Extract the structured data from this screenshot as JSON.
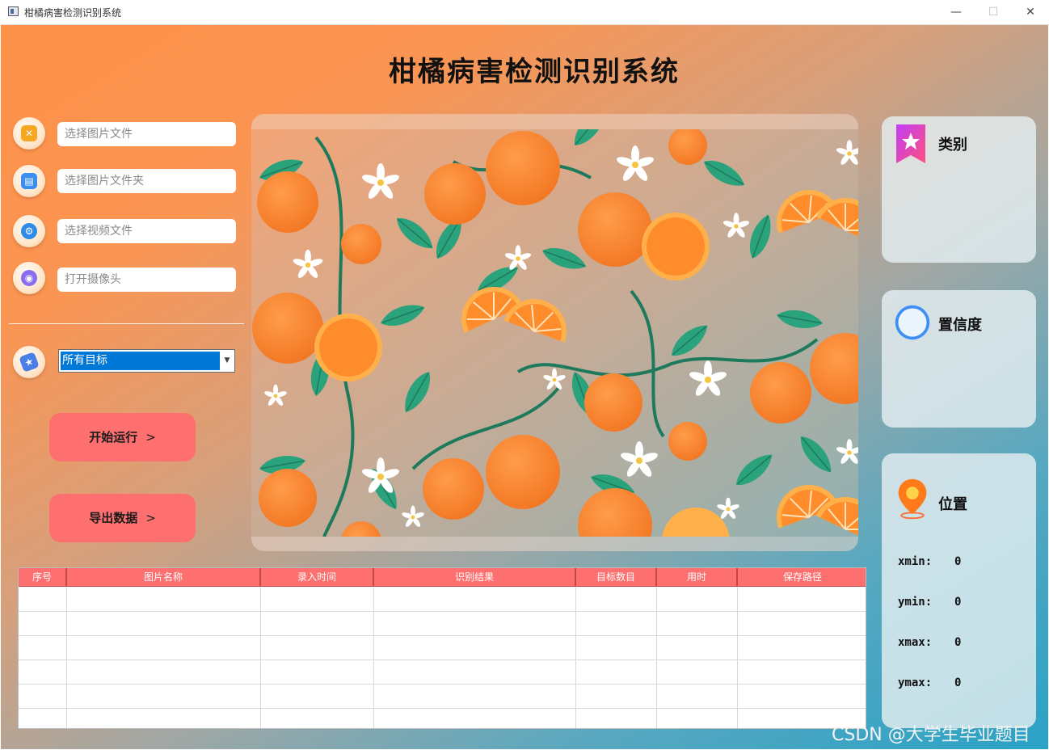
{
  "window": {
    "title": "柑橘病害检测识别系统",
    "minimize": "—",
    "maximize": "☐",
    "close": "✕"
  },
  "app_title": "柑橘病害检测识别系统",
  "sidebar": {
    "inputs": [
      {
        "placeholder": "选择图片文件",
        "icon": "image-file-icon"
      },
      {
        "placeholder": "选择图片文件夹",
        "icon": "folder-icon"
      },
      {
        "placeholder": "选择视频文件",
        "icon": "video-reel-icon"
      },
      {
        "placeholder": "打开摄像头",
        "icon": "camera-icon"
      }
    ],
    "target_select": {
      "value": "所有目标",
      "icon": "tag-icon"
    },
    "start_button": "开始运行",
    "export_button": "导出数据",
    "chevron": ">"
  },
  "cards": {
    "category": {
      "label": "类别",
      "value": ""
    },
    "confidence": {
      "label": "置信度",
      "value": ""
    },
    "position": {
      "label": "位置",
      "xmin_label": "xmin:",
      "xmin": "0",
      "ymin_label": "ymin:",
      "ymin": "0",
      "xmax_label": "xmax:",
      "xmax": "0",
      "ymax_label": "ymax:",
      "ymax": "0"
    }
  },
  "table": {
    "columns": [
      "序号",
      "图片名称",
      "录入时间",
      "识别结果",
      "目标数目",
      "用时",
      "保存路径"
    ],
    "rows": [
      [],
      [],
      [],
      [],
      [],
      []
    ]
  },
  "watermark": "CSDN @大学生毕业题目",
  "colors": {
    "accent": "#fe6f6f",
    "selection": "#0078d7",
    "gradient_start": "#fe9148",
    "gradient_end": "#2aa2c6"
  }
}
